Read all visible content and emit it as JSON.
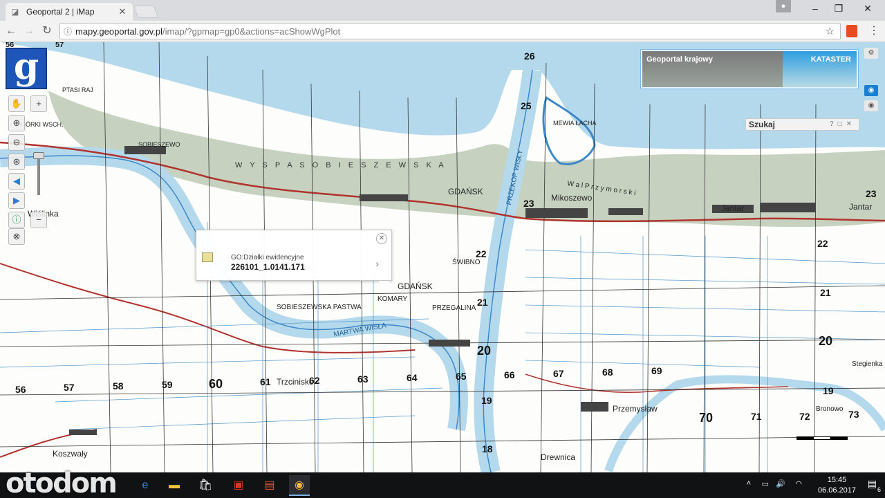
{
  "browser": {
    "tab_title": "Geoportal 2 | iMap",
    "url_host": "mapy.geoportal.gov.pl",
    "url_path": "/imap/?gpmap=gp0&actions=acShowWgPlot"
  },
  "map": {
    "layers": {
      "geoportal_label": "Geoportal krajowy",
      "kataster_label": "KATASTER"
    },
    "search_panel": {
      "title": "Szukaj"
    },
    "popup": {
      "layer_name": "GO:Działki ewidencyjne",
      "parcel_id": "226101_1.0141.171"
    },
    "grid_numbers": {
      "n26": "26",
      "n25": "25",
      "n23a": "23",
      "n23b": "23",
      "n22a": "22",
      "n22b": "22",
      "n21a": "21",
      "n21b": "21",
      "n20a": "20",
      "n20b": "20",
      "n19a": "19",
      "n19b": "19",
      "n18": "18",
      "n56": "56",
      "n57": "57",
      "n58": "58",
      "n59": "59",
      "n60": "60",
      "n61": "61",
      "n62": "62",
      "n63": "63",
      "n64": "64",
      "n65": "65",
      "n66": "66",
      "n67": "67",
      "n68": "68",
      "n69": "69",
      "n70": "70",
      "n71": "71",
      "n72": "72",
      "n73": "73",
      "n56top": "56",
      "n57top": "57"
    },
    "place_names": {
      "wyspa": "W Y S P A     S O B I E S Z E W S K A",
      "gdansk_top": "GDAŃSK",
      "gdansk_mid": "GDAŃSK",
      "mikoszewo": "Mikoszewo",
      "jantar_a": "Jantar",
      "jantar_b": "Jantar",
      "sobieszewska_pastwa": "SOBIESZEWSKA PASTWA",
      "komary": "KOMARY",
      "przegalina": "PRZEGALINA",
      "swibno_mid": "ŚWIBNO",
      "trzcinisko": "Trzcinisko",
      "przemyslaw": "Przemysław",
      "drewnica": "Drewnica",
      "koszwaly": "Koszwały",
      "wislinka": "Wiślinka",
      "stegienka": "Stegienka",
      "bronowo": "Bronowo",
      "martwa_wisla": "MARTWA WISŁA",
      "przekop_wisly": "PRZEKOP WISŁY",
      "ptasi_raj": "PTASI RAJ",
      "mewia_lacha": "MEWIA ŁACHA",
      "gorki_wsch": "GÓRKI WSCH.",
      "sobieszewo": "SOBIESZEWO",
      "w_przymorski": "W a l   P r z y m o r s k i"
    }
  },
  "taskbar": {
    "time": "15:45",
    "date": "06.06.2017",
    "notif_count": "6",
    "watermark": "otodom"
  },
  "colors": {
    "forest": "#b8c7b0",
    "water": "#b4d9ec",
    "river_dark": "#3c88c8",
    "road": "#b2332e",
    "grid": "#333333"
  }
}
